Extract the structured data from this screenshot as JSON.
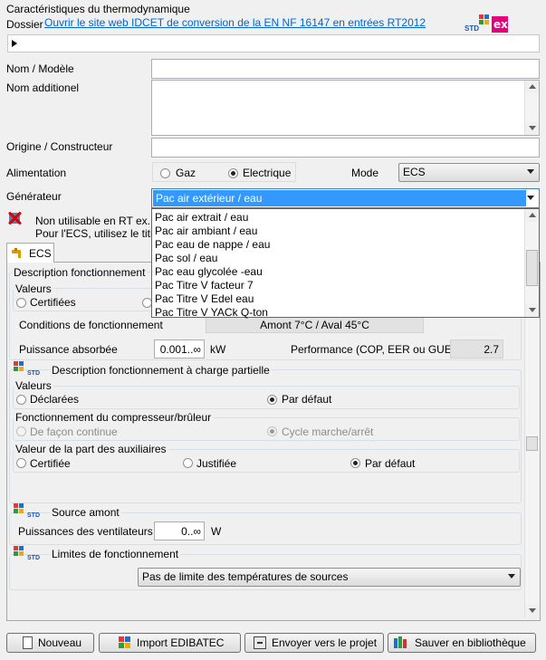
{
  "header": {
    "title": "Caractéristiques du thermodynamique",
    "dossier_label": "Dossier",
    "dossier_link": "Ouvrir le site web IDCET de conversion de la EN NF 16147 en entrées RT2012"
  },
  "fields": {
    "nom_label": "Nom / Modèle",
    "nom_value": "",
    "nom_add_label": "Nom additionel",
    "nom_add_value": "",
    "origine_label": "Origine / Constructeur",
    "origine_value": "",
    "alimentation_label": "Alimentation",
    "alimentation_options": [
      "Gaz",
      "Electrique"
    ],
    "alimentation_selected": "Electrique",
    "mode_label": "Mode",
    "mode_value": "ECS",
    "generateur_label": "Générateur",
    "generateur_value": "Pac air extérieur / eau"
  },
  "dropdown": {
    "items": [
      "Pac air extrait / eau",
      "Pac air ambiant / eau",
      "Pac eau de nappe / eau",
      "Pac sol / eau",
      "Pac eau glycolée -eau",
      "Pac Titre V facteur 7",
      "Pac Titre V Edel eau",
      "Pac Titre V YACk Q-ton"
    ]
  },
  "warning": {
    "line1": "Non utilisable en RT ex.",
    "line2": "Pour l'ECS, utilisez le titre"
  },
  "tab": {
    "label": "ECS"
  },
  "ecs": {
    "desc_title": "Description fonctionnement",
    "valeurs_label": "Valeurs",
    "certifiees": "Certifiées",
    "conditions_label": "Conditions de fonctionnement",
    "conditions_value": "Amont 7°C / Aval 45°C",
    "puissance_label": "Puissance absorbée",
    "puissance_value": "0.001..∞",
    "puissance_unit": "kW",
    "performance_label": "Performance (COP, EER ou GUE)",
    "performance_value": "2.7"
  },
  "charge": {
    "title": "Description fonctionnement à charge partielle",
    "valeurs_label": "Valeurs",
    "declarees": "Déclarées",
    "par_defaut": "Par défaut",
    "compresseur_label": "Fonctionnement du compresseur/brûleur",
    "continue": "De façon continue",
    "cycle": "Cycle marche/arrêt",
    "auxiliaires_label": "Valeur de la part des auxiliaires",
    "certifiee": "Certifiée",
    "justifiee": "Justifiée",
    "aux_par_defaut": "Par défaut"
  },
  "source": {
    "title": "Source amont",
    "ventilateurs_label": "Puissances des ventilateurs",
    "ventilateurs_value": "0..∞",
    "ventilateurs_unit": "W"
  },
  "limites": {
    "title": "Limites de fonctionnement",
    "value": "Pas de limite des températures de sources"
  },
  "buttons": {
    "nouveau": "Nouveau",
    "import": "Import EDIBATEC",
    "envoyer": "Envoyer vers le projet",
    "sauver": "Sauver en bibliothèque"
  },
  "logo": {
    "std": "STD",
    "ex": "ex"
  }
}
